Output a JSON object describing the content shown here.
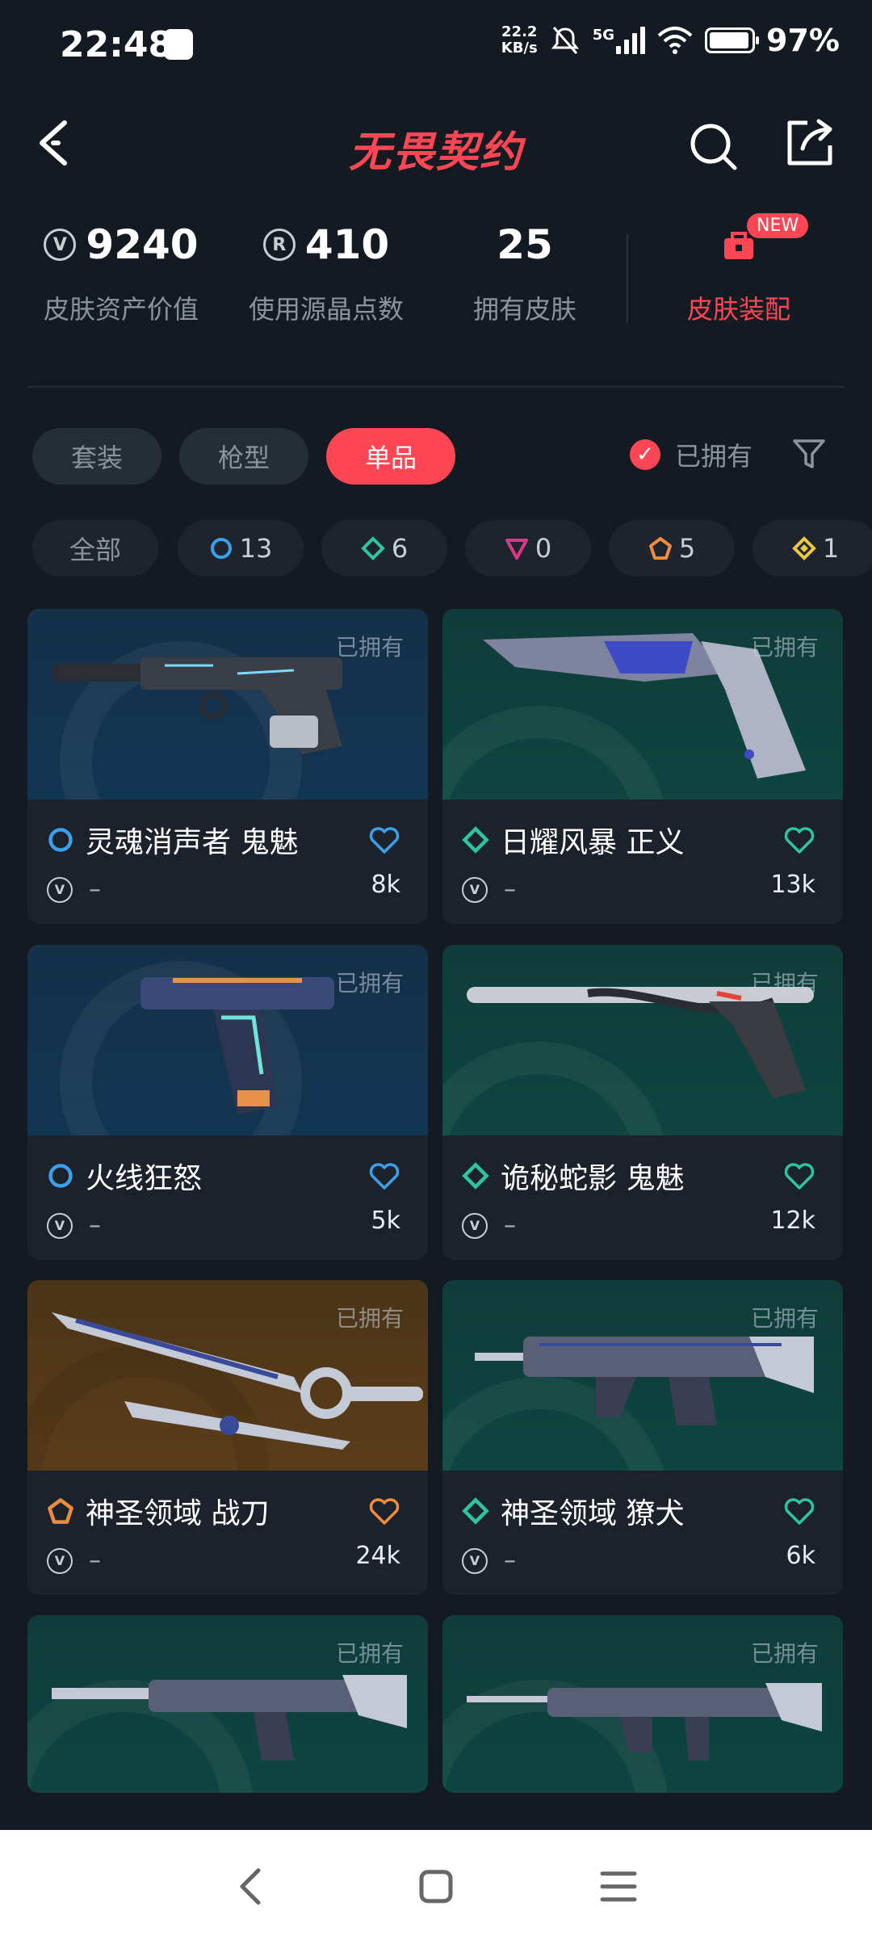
{
  "status_bar": {
    "time": "22:48",
    "net_speed_value": "22.2",
    "net_speed_unit": "KB/s",
    "network": "5G",
    "battery": "97%"
  },
  "header": {
    "title": "无畏契约"
  },
  "stats": {
    "asset_value": {
      "value": "9240",
      "label": "皮肤资产价值"
    },
    "radianite": {
      "value": "410",
      "label": "使用源晶点数"
    },
    "owned": {
      "value": "25",
      "label": "拥有皮肤"
    },
    "loadout": {
      "label": "皮肤装配",
      "badge": "NEW"
    }
  },
  "tabs": [
    {
      "label": "套装",
      "active": false
    },
    {
      "label": "枪型",
      "active": false
    },
    {
      "label": "单品",
      "active": true
    }
  ],
  "owned_filter": {
    "label": "已拥有",
    "checked": true
  },
  "rarity_chips": [
    {
      "label": "全部"
    },
    {
      "count": "13",
      "color": "#3aa0e8"
    },
    {
      "count": "6",
      "color": "#2fc59a"
    },
    {
      "count": "0",
      "color": "#e0368a"
    },
    {
      "count": "5",
      "color": "#f08c3c"
    },
    {
      "count": "1",
      "color": "#f0c83c"
    }
  ],
  "owned_tag": "已拥有",
  "skins": [
    {
      "name": "灵魂消声者 鬼魅",
      "price": "–",
      "likes": "8k",
      "rarity_color": "#3aa0e8"
    },
    {
      "name": "日耀风暴 正义",
      "price": "–",
      "likes": "13k",
      "rarity_color": "#2fc59a"
    },
    {
      "name": "火线狂怒",
      "price": "–",
      "likes": "5k",
      "rarity_color": "#3aa0e8"
    },
    {
      "name": "诡秘蛇影 鬼魅",
      "price": "–",
      "likes": "12k",
      "rarity_color": "#2fc59a"
    },
    {
      "name": "神圣领域 战刀",
      "price": "–",
      "likes": "24k",
      "rarity_color": "#f08c3c"
    },
    {
      "name": "神圣领域 獠犬",
      "price": "–",
      "likes": "6k",
      "rarity_color": "#2fc59a"
    }
  ]
}
